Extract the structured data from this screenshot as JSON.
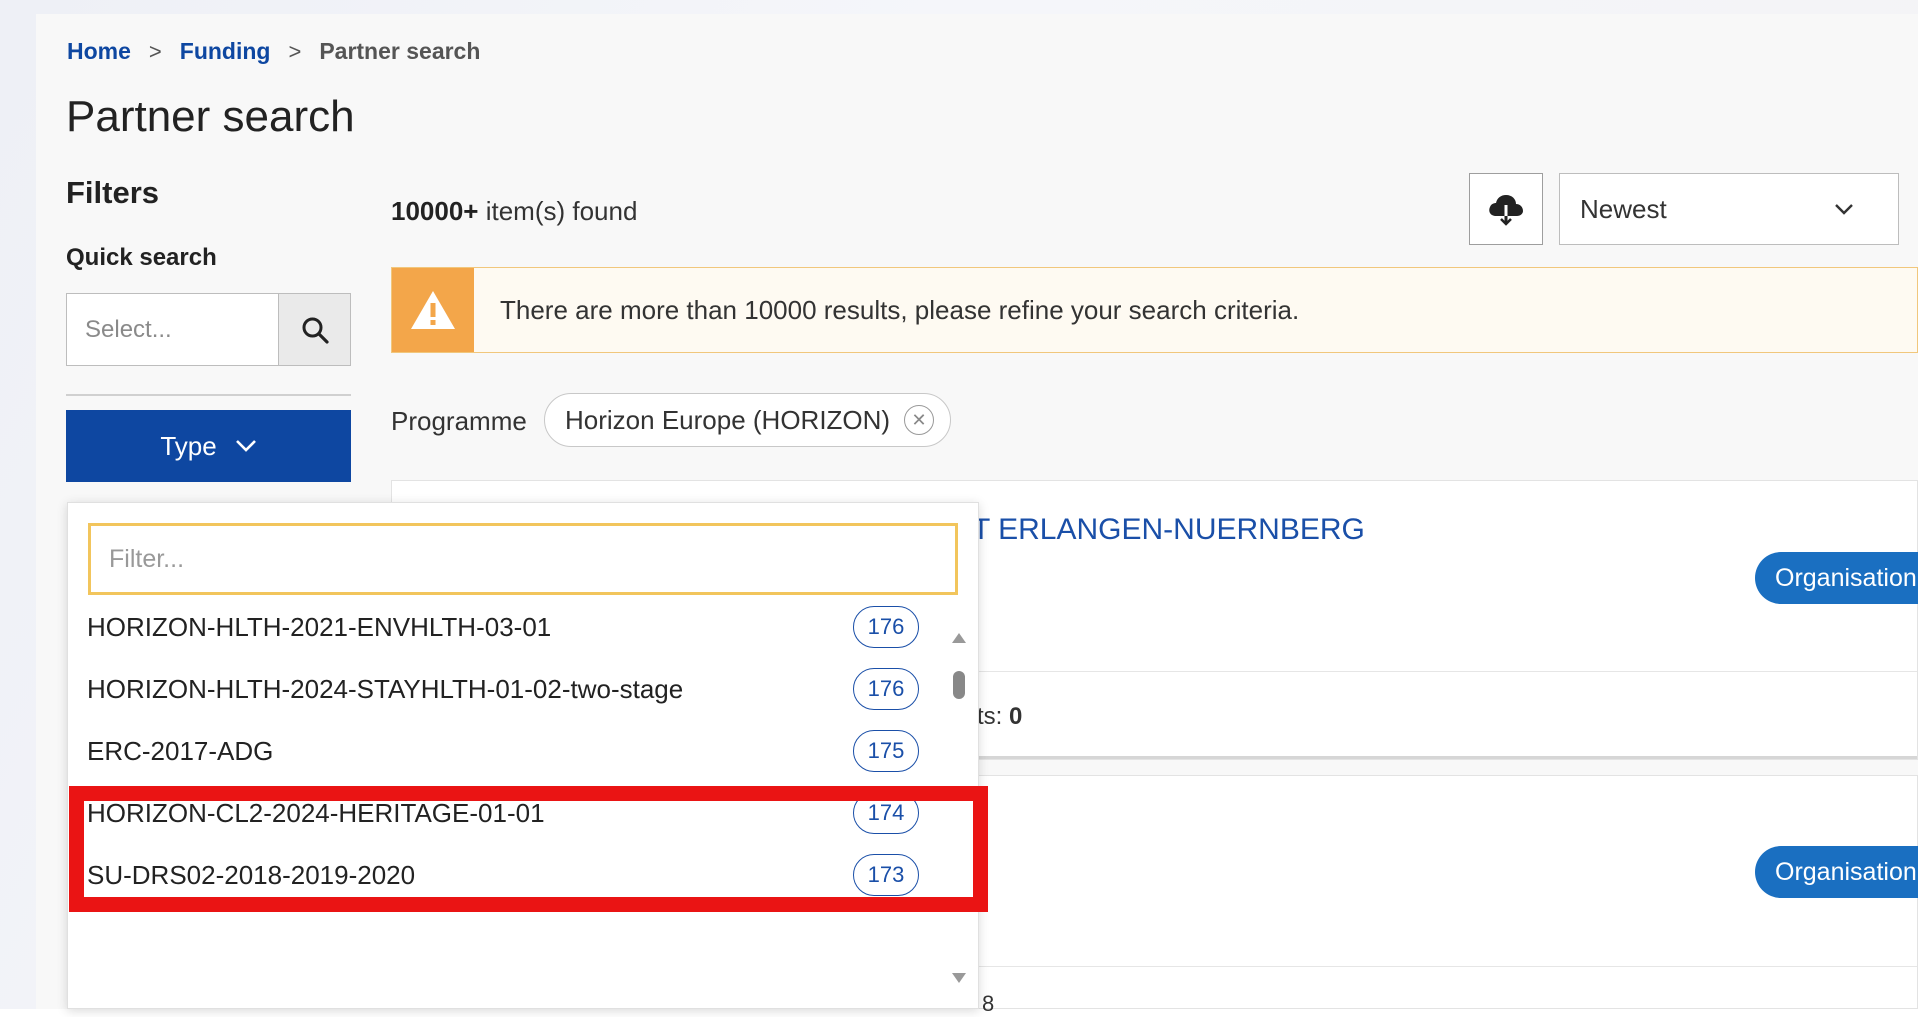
{
  "breadcrumb": {
    "home": "Home",
    "funding": "Funding",
    "current": "Partner search",
    "separator": ">"
  },
  "page_title": "Partner search",
  "filters": {
    "heading": "Filters",
    "quick_search_label": "Quick search",
    "quick_search_placeholder": "Select...",
    "type_button_label": "Type"
  },
  "results": {
    "count_bold": "10000+",
    "count_suffix": " item(s) found",
    "sort_value": "Newest",
    "alert_text": "There are more than 10000 results, please refine your search criteria.",
    "programme_label": "Programme",
    "programme_chip": "Horizon Europe (HORIZON)"
  },
  "cards": [
    {
      "title_partial": "ET ERLANGEN-NUERNBERG",
      "badge": "Organisation",
      "meta_partial": "ts:",
      "meta_value": "0"
    },
    {
      "badge": "Organisation",
      "meta_partial": "8"
    }
  ],
  "dropdown": {
    "filter_placeholder": "Filter...",
    "options": [
      {
        "label": "HORIZON-HLTH-2021-ENVHLTH-03-01",
        "count": "176"
      },
      {
        "label": "HORIZON-HLTH-2024-STAYHLTH-01-02-two-stage",
        "count": "176"
      },
      {
        "label": "ERC-2017-ADG",
        "count": "175"
      },
      {
        "label": "HORIZON-CL2-2024-HERITAGE-01-01",
        "count": "174"
      },
      {
        "label": "SU-DRS02-2018-2019-2020",
        "count": "173"
      }
    ]
  },
  "colors": {
    "primary": "#0e47a1",
    "badge": "#1a6fc1",
    "warning": "#f3a64a",
    "highlight": "#ea1414",
    "filter_border": "#f2c55c"
  }
}
